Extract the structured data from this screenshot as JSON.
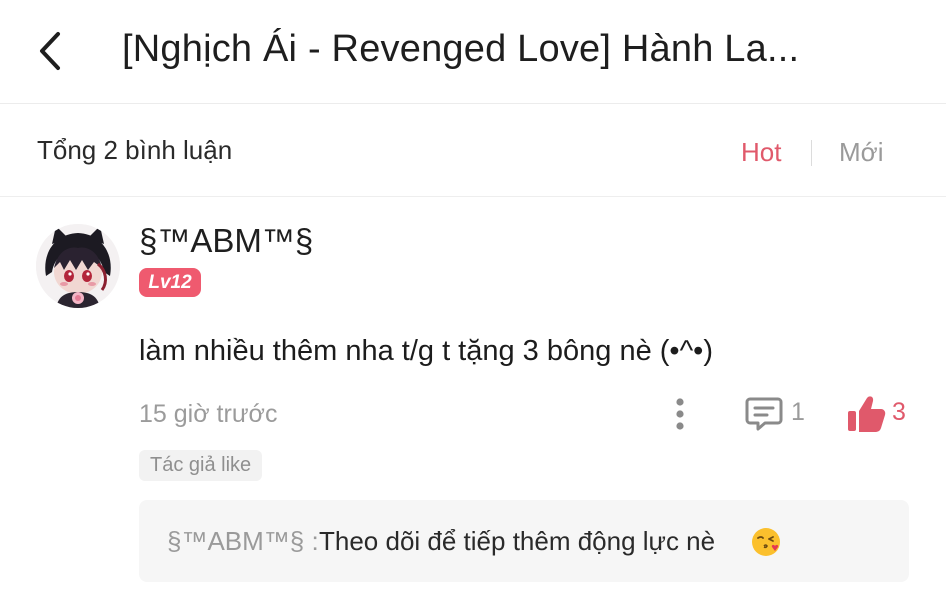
{
  "header": {
    "title": "[Nghịch Ái - Revenged Love] Hành La..."
  },
  "summary": {
    "total": "Tổng 2 bình luận",
    "sort_hot": "Hot",
    "sort_new": "Mới"
  },
  "comment": {
    "username": "§™ABM™§",
    "level": "Lv12",
    "text": "làm nhiều thêm nha t/g t tặng 3 bông nè (•^•)",
    "time": "15 giờ trước",
    "reply_count": "1",
    "like_count": "3",
    "author_like": "Tác giả like",
    "reply": {
      "user": "§™ABM™§ :",
      "text": "Theo dõi để tiếp thêm động lực nè",
      "emoji": "face-blowing-kiss-icon"
    }
  },
  "colors": {
    "accent": "#e0596b",
    "level_badge": "#ef5a6f",
    "muted": "#9b9b9b"
  }
}
